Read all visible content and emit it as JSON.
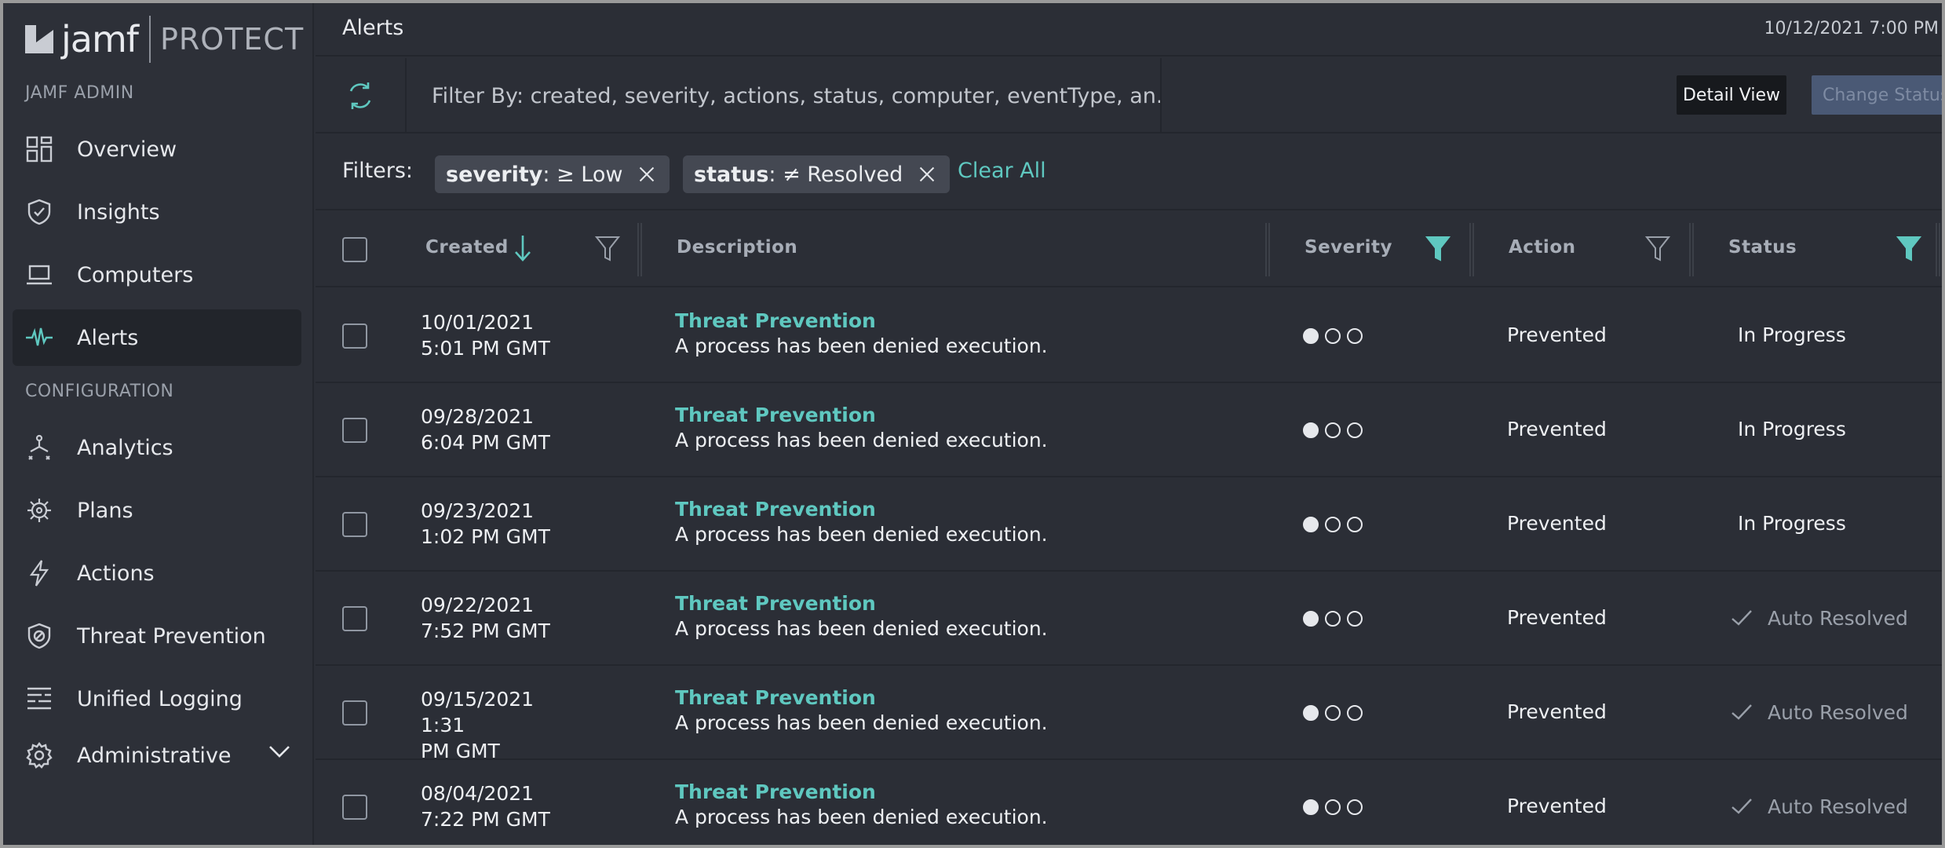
{
  "brand": {
    "name": "jamf",
    "product": "PROTECT"
  },
  "sidebar": {
    "section_admin": "JAMF ADMIN",
    "section_config": "CONFIGURATION",
    "items": [
      {
        "label": "Overview",
        "icon": "dashboard-grid-icon"
      },
      {
        "label": "Insights",
        "icon": "shield-check-icon"
      },
      {
        "label": "Computers",
        "icon": "laptop-icon"
      },
      {
        "label": "Alerts",
        "icon": "pulse-icon",
        "active": true
      },
      {
        "label": "Analytics",
        "icon": "analytics-flow-icon"
      },
      {
        "label": "Plans",
        "icon": "gear-bug-icon"
      },
      {
        "label": "Actions",
        "icon": "lightning-icon"
      },
      {
        "label": "Threat Prevention",
        "icon": "shield-block-icon"
      },
      {
        "label": "Unified Logging",
        "icon": "log-lines-icon"
      },
      {
        "label": "Administrative",
        "icon": "gear-icon"
      }
    ]
  },
  "header": {
    "title": "Alerts",
    "datetime": "10/12/2021 7:00 PM"
  },
  "toolbar": {
    "filter_placeholder": "Filter By: created, severity, actions, status, computer, eventType, an...",
    "detail_view_label": "Detail View",
    "change_status_label": "Change Status"
  },
  "filters": {
    "label": "Filters:",
    "chips": [
      {
        "key": "severity",
        "op": " : ≥ Low"
      },
      {
        "key": "status",
        "op": " : ≠ Resolved"
      }
    ],
    "clear_all": "Clear All"
  },
  "table": {
    "columns": {
      "created": "Created",
      "description": "Description",
      "severity": "Severity",
      "action": "Action",
      "status": "Status"
    },
    "rows": [
      {
        "date": "10/01/2021",
        "time": "5:01 PM GMT",
        "title": "Threat Prevention",
        "desc": "A process has been denied execution.",
        "severity": 1,
        "action": "Prevented",
        "status": "In Progress"
      },
      {
        "date": "09/28/2021",
        "time": "6:04 PM GMT",
        "title": "Threat Prevention",
        "desc": "A process has been denied execution.",
        "severity": 1,
        "action": "Prevented",
        "status": "In Progress"
      },
      {
        "date": "09/23/2021",
        "time": "1:02 PM GMT",
        "title": "Threat Prevention",
        "desc": "A process has been denied execution.",
        "severity": 1,
        "action": "Prevented",
        "status": "In Progress"
      },
      {
        "date": "09/22/2021",
        "time": "7:52 PM GMT",
        "title": "Threat Prevention",
        "desc": "A process has been denied execution.",
        "severity": 1,
        "action": "Prevented",
        "status": "Auto Resolved"
      },
      {
        "date": "09/15/2021 1:31",
        "time": "PM GMT",
        "title": "Threat Prevention",
        "desc": "A process has been denied execution.",
        "severity": 1,
        "action": "Prevented",
        "status": "Auto Resolved"
      },
      {
        "date": "08/04/2021",
        "time": "7:22 PM GMT",
        "title": "Threat Prevention",
        "desc": "A process has been denied execution.",
        "severity": 1,
        "action": "Prevented",
        "status": "Auto Resolved"
      }
    ]
  },
  "colors": {
    "accent": "#5fc8c0",
    "background": "#2b2e36",
    "sidebar": "#2d3038"
  }
}
